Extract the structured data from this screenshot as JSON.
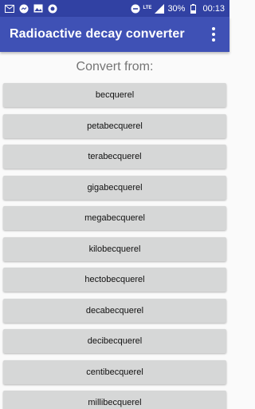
{
  "status_bar": {
    "battery_percent": "30%",
    "time": "00:13",
    "network": "LTE",
    "left_icons": [
      "gmail-icon",
      "messenger-icon",
      "image-icon",
      "app-circle-icon"
    ],
    "right_icons": [
      "minus-circle-icon",
      "lte-signal-icon",
      "signal-icon",
      "battery-icon"
    ]
  },
  "app_bar": {
    "title": "Radioactive decay converter",
    "overflow_icon": "more-vert-icon"
  },
  "main": {
    "section_title": "Convert from:",
    "units": [
      "becquerel",
      "petabecquerel",
      "terabecquerel",
      "gigabecquerel",
      "megabecquerel",
      "kilobecquerel",
      "hectobecquerel",
      "decabecquerel",
      "decibecquerel",
      "centibecquerel",
      "millibecquerel"
    ]
  },
  "colors": {
    "app_bar": "#3f51b5",
    "status_bar": "#3141a3",
    "button": "#d6d7d7",
    "background": "#fafafa"
  }
}
